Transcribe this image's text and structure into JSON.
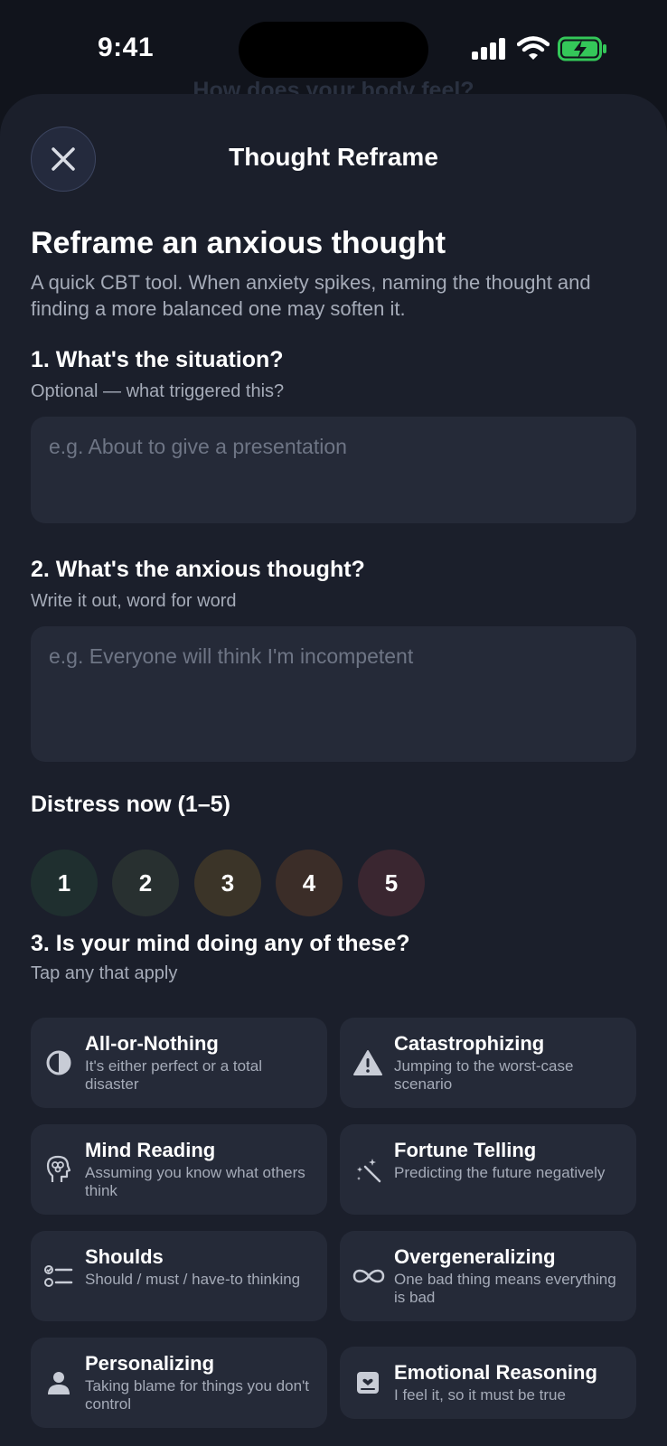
{
  "status": {
    "time": "9:41"
  },
  "background_screen": {
    "heading": "How does your body feel?"
  },
  "sheet": {
    "title": "Thought Reframe",
    "heading": "Reframe an anxious thought",
    "intro": "A quick CBT tool. When anxiety spikes, naming the thought and finding a more balanced one may soften it."
  },
  "situation": {
    "question": "1. What's the situation?",
    "hint": "Optional — what triggered this?",
    "placeholder": "e.g. About to give a presentation",
    "value": ""
  },
  "thought": {
    "question": "2. What's the anxious thought?",
    "hint": "Write it out, word for word",
    "placeholder": "e.g. Everyone will think I'm incompetent",
    "value": ""
  },
  "distress": {
    "label": "Distress now (1–5)",
    "options": [
      {
        "label": "1",
        "color": "#1f2f2f"
      },
      {
        "label": "2",
        "color": "#283030"
      },
      {
        "label": "3",
        "color": "#3b3428"
      },
      {
        "label": "4",
        "color": "#3b2d28"
      },
      {
        "label": "5",
        "color": "#3a2630"
      }
    ]
  },
  "distortions": {
    "question": "3. Is your mind doing any of these?",
    "hint": "Tap any that apply",
    "items": [
      {
        "title": "All-or-Nothing",
        "desc": "It's either perfect or a total disaster",
        "icon": "half-circle-icon"
      },
      {
        "title": "Catastrophizing",
        "desc": "Jumping to the worst-case scenario",
        "icon": "warning-icon"
      },
      {
        "title": "Mind Reading",
        "desc": "Assuming you know what others think",
        "icon": "head-brain-icon"
      },
      {
        "title": "Fortune Telling",
        "desc": "Predicting the future negatively",
        "icon": "magic-wand-icon"
      },
      {
        "title": "Shoulds",
        "desc": "Should / must / have-to thinking",
        "icon": "checklist-icon"
      },
      {
        "title": "Overgeneralizing",
        "desc": "One bad thing means everything is bad",
        "icon": "infinity-icon"
      },
      {
        "title": "Personalizing",
        "desc": "Taking blame for things you don't control",
        "icon": "person-icon"
      },
      {
        "title": "Emotional Reasoning",
        "desc": "I feel it, so it must be true",
        "icon": "journal-icon"
      }
    ]
  },
  "colors": {
    "sheet_bg": "#1b1f2b",
    "card_bg": "#252a38",
    "muted_text": "#a5abb8",
    "battery_green": "#34c759"
  }
}
